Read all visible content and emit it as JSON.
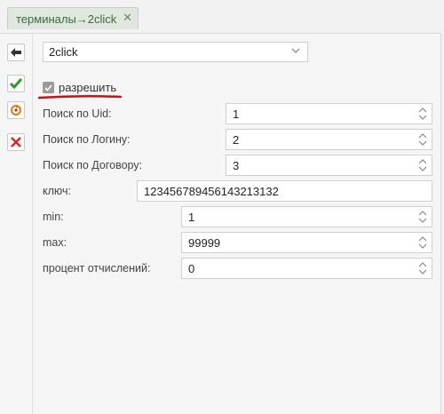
{
  "tab": {
    "label": "терминалы→2click",
    "close_glyph": "✕"
  },
  "toolbar": {
    "back_icon": "arrow-left-icon",
    "save_icon": "checkmark-icon",
    "refresh_icon": "refresh-icon",
    "cancel_icon": "x-icon"
  },
  "selector": {
    "value": "2click"
  },
  "enable": {
    "label": "разрешить",
    "checked": true
  },
  "fields": [
    {
      "label": "Поиск по Uid:",
      "value": "1"
    },
    {
      "label": "Поиск по Логину:",
      "value": "2"
    },
    {
      "label": "Поиск по Договору:",
      "value": "3"
    },
    {
      "label": "ключ:",
      "value": "123456789456143213132"
    },
    {
      "label": "min:",
      "value": "1"
    },
    {
      "label": "max:",
      "value": "99999"
    },
    {
      "label": "процент отчислений:",
      "value": "0"
    }
  ],
  "colors": {
    "accent_green": "#2a9a2a",
    "cancel_red": "#d9261c",
    "underline_red": "#c0141c"
  }
}
